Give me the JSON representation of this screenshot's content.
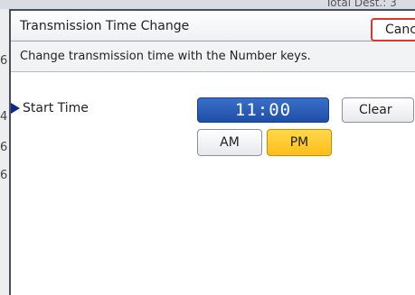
{
  "background": {
    "top_text": "Total Dest.: 3",
    "left_digits": [
      "6",
      "4",
      "6",
      "6"
    ]
  },
  "dialog": {
    "title": "Transmission Time Change",
    "cancel_label": "Cancel",
    "instruction": "Change transmission time with the Number keys.",
    "start_time_label": "Start Time",
    "time_value": "11:00",
    "clear_label": "Clear",
    "am_label": "AM",
    "pm_label": "PM",
    "selected_period": "PM"
  },
  "colors": {
    "time_display": "#2a5cb8",
    "selected_button": "#ffc72c",
    "cancel_border": "#d9382c"
  }
}
